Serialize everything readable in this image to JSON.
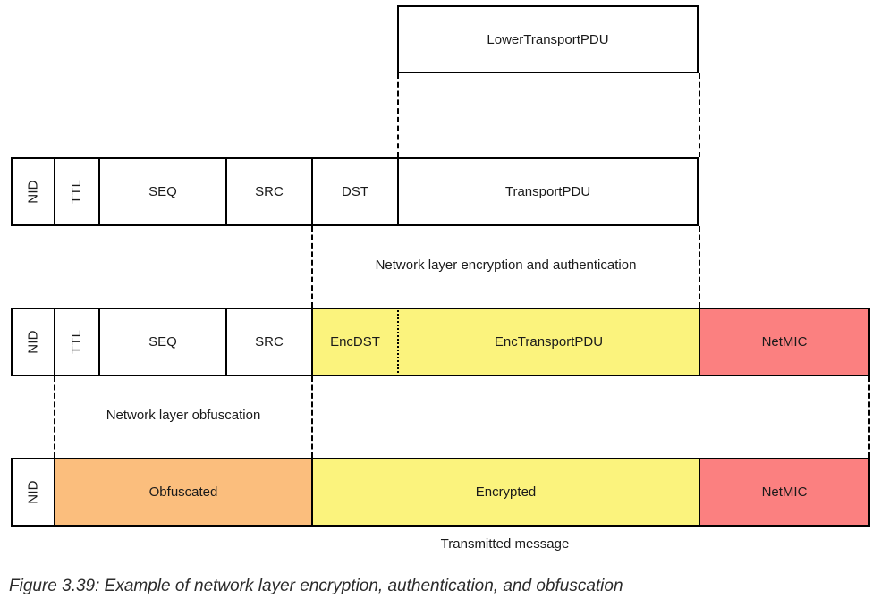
{
  "figure": {
    "caption": "Figure 3.39: Example of network layer encryption, authentication, and obfuscation",
    "transmitted_label": "Transmitted message",
    "colors": {
      "yellow": "#FBF37D",
      "salmon": "#FB8080",
      "orange": "#FBBE7D",
      "white": "#FFFFFF",
      "stroke": "#000000",
      "text": "#1A1A1A",
      "caption_text": "#2B2B2B"
    },
    "top_box": {
      "label": "LowerTransportPDU"
    },
    "row_plain": {
      "cells": [
        {
          "label": "NID",
          "rotated": true
        },
        {
          "label": "TTL",
          "rotated": true
        },
        {
          "label": "SEQ",
          "rotated": false
        },
        {
          "label": "SRC",
          "rotated": false
        },
        {
          "label": "DST",
          "rotated": false
        },
        {
          "label": "TransportPDU",
          "rotated": false
        }
      ]
    },
    "annotation_encryption": "Network layer encryption and authentication",
    "row_encrypted": {
      "cells": [
        {
          "label": "NID",
          "rotated": true
        },
        {
          "label": "TTL",
          "rotated": true
        },
        {
          "label": "SEQ",
          "rotated": false
        },
        {
          "label": "SRC",
          "rotated": false
        },
        {
          "label": "EncDST",
          "rotated": false
        },
        {
          "label": "EncTransportPDU",
          "rotated": false
        },
        {
          "label": "NetMIC",
          "rotated": false
        }
      ]
    },
    "annotation_obfuscation": "Network layer obfuscation",
    "row_transmitted": {
      "cells": [
        {
          "label": "NID",
          "rotated": true
        },
        {
          "label": "Obfuscated",
          "rotated": false
        },
        {
          "label": "Encrypted",
          "rotated": false
        },
        {
          "label": "NetMIC",
          "rotated": false
        }
      ]
    }
  }
}
